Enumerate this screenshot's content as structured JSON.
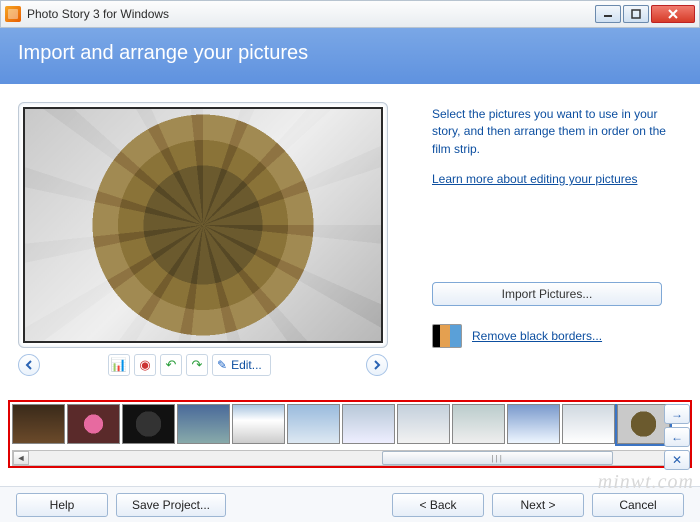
{
  "window": {
    "title": "Photo Story 3 for Windows"
  },
  "header": {
    "title": "Import and arrange your pictures"
  },
  "instructions": {
    "text": "Select the pictures you want to use in your story, and then arrange them in order on the film strip.",
    "learn_link": "Learn more about editing your pictures"
  },
  "preview_toolbar": {
    "edit_label": "Edit..."
  },
  "actions": {
    "import_button": "Import Pictures...",
    "remove_borders_link": "Remove black borders..."
  },
  "filmstrip": {
    "selected_index": 11
  },
  "footer": {
    "help": "Help",
    "save": "Save Project...",
    "back": "< Back",
    "next": "Next >",
    "cancel": "Cancel"
  },
  "watermark": "minwt.com"
}
